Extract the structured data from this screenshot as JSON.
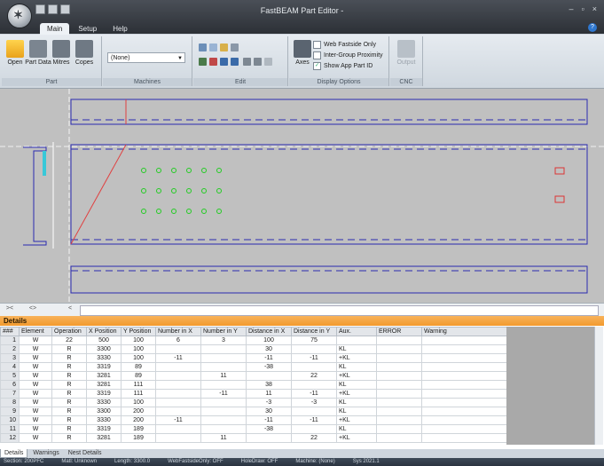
{
  "window": {
    "title": "FastBEAM Part Editor -",
    "controls": [
      "–",
      "▫",
      "×"
    ],
    "help": "?"
  },
  "tabs": [
    "Main",
    "Setup",
    "Help"
  ],
  "ribbon": {
    "part": {
      "label": "Part",
      "buttons": [
        "Open",
        "Part Data",
        "Mitres",
        "Copes"
      ]
    },
    "machines": {
      "label": "Machines",
      "selected": "(None)"
    },
    "edit": {
      "label": "Edit"
    },
    "display": {
      "label": "Display Options",
      "axes_label": "Axes",
      "checks": [
        {
          "label": "Web Fastside Only",
          "checked": false
        },
        {
          "label": "Inter-Group Proximity",
          "checked": false
        },
        {
          "label": "Show App Part ID",
          "checked": true
        }
      ]
    },
    "cnc": {
      "label": "CNC",
      "output_label": "Output"
    }
  },
  "scroll_buttons": [
    "><",
    "<>",
    "<"
  ],
  "details": {
    "title": "Details",
    "columns": [
      "###",
      "Element",
      "Operation",
      "X Position",
      "Y Position",
      "Number in X",
      "Number in Y",
      "Distance in X",
      "Distance in Y",
      "Aux.",
      "ERROR",
      "Warning"
    ],
    "rows": [
      [
        "1",
        "W",
        "22",
        "500",
        "100",
        "6",
        "3",
        "100",
        "75",
        "",
        "",
        ""
      ],
      [
        "2",
        "W",
        "R",
        "3300",
        "100",
        "",
        "",
        "30",
        "",
        "KL",
        "",
        ""
      ],
      [
        "3",
        "W",
        "R",
        "3330",
        "100",
        "-11",
        "",
        "-11",
        "-11",
        "+KL",
        "",
        ""
      ],
      [
        "4",
        "W",
        "R",
        "3319",
        "89",
        "",
        "",
        "-38",
        "",
        "KL",
        "",
        ""
      ],
      [
        "5",
        "W",
        "R",
        "3281",
        "89",
        "",
        "11",
        "",
        "22",
        "+KL",
        "",
        ""
      ],
      [
        "6",
        "W",
        "R",
        "3281",
        "111",
        "",
        "",
        "38",
        "",
        "KL",
        "",
        ""
      ],
      [
        "7",
        "W",
        "R",
        "3319",
        "111",
        "",
        "-11",
        "11",
        "-11",
        "+KL",
        "",
        ""
      ],
      [
        "8",
        "W",
        "R",
        "3330",
        "100",
        "",
        "",
        "-3",
        "-3",
        "KL",
        "",
        ""
      ],
      [
        "9",
        "W",
        "R",
        "3300",
        "200",
        "",
        "",
        "30",
        "",
        "KL",
        "",
        ""
      ],
      [
        "10",
        "W",
        "R",
        "3330",
        "200",
        "-11",
        "",
        "-11",
        "-11",
        "+KL",
        "",
        ""
      ],
      [
        "11",
        "W",
        "R",
        "3319",
        "189",
        "",
        "",
        "-38",
        "",
        "KL",
        "",
        ""
      ],
      [
        "12",
        "W",
        "R",
        "3281",
        "189",
        "",
        "11",
        "",
        "22",
        "+KL",
        "",
        ""
      ]
    ]
  },
  "bottom_tabs": [
    "Details",
    "Warnings",
    "Nest Details"
  ],
  "status": [
    "Section: 200PFC",
    "Matl: Unknown",
    "Length: 3300.0",
    "WebFastsideOnly: OFF",
    "HoleDraw: OFF",
    "Machine: (None)",
    "Sys 2021.1"
  ],
  "colors": {
    "flange_line": "#2a2ab0",
    "hole": "#22cc22",
    "rect_hole": "#dd3333",
    "mitre": "#e04040",
    "header_orange": "#f29a2e"
  }
}
